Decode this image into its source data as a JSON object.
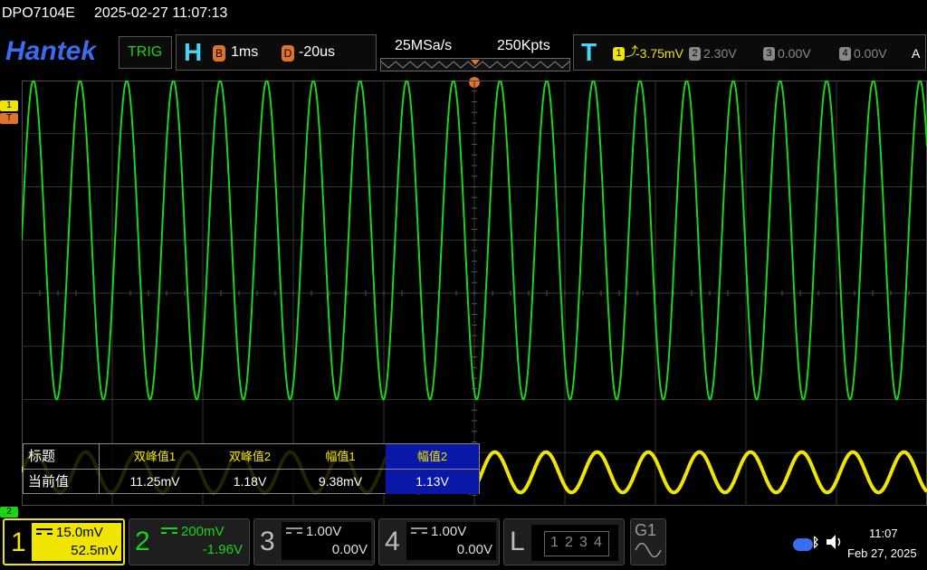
{
  "status": {
    "model": "DPO7104E",
    "datetime": "2025-02-27 11:07:13"
  },
  "header": {
    "brand": "Hantek",
    "trig_button": "TRIG",
    "horizontal": {
      "icon": "H",
      "b_tag": "B",
      "timebase": "1ms",
      "d_tag": "D",
      "delay": "-20us"
    },
    "acquisition": {
      "sample_rate": "25MSa/s",
      "record_length": "250Kpts"
    },
    "trigger": {
      "icon": "T",
      "source_tag": "1",
      "source_level": "-3.75mV",
      "ch2_tag": "2",
      "ch2_level": "2.30V",
      "ch3_tag": "3",
      "ch3_level": "0.00V",
      "ch4_tag": "4",
      "ch4_level": "0.00V",
      "mode": "A",
      "edge_icon": "rising-edge-icon"
    }
  },
  "markers": {
    "ch1": "1",
    "trigger": "T",
    "ch2": "2"
  },
  "waveforms": {
    "ch1": {
      "color": "#f0e500",
      "cycles": 17.7,
      "amplitude_div": 0.38,
      "center_div": -3.37
    },
    "ch2": {
      "color": "#19d419",
      "cycles": 19.4,
      "amplitude_div": 3.0,
      "center_div": 1.0
    }
  },
  "measurements": {
    "header_label": "标题",
    "row_label": "当前值",
    "columns": [
      "双峰值1",
      "双峰值2",
      "幅值1",
      "幅值2"
    ],
    "values": [
      "11.25mV",
      "1.18V",
      "9.38mV",
      "1.13V"
    ]
  },
  "channels": [
    {
      "num": "1",
      "scale": "15.0mV",
      "offset": "52.5mV",
      "color": "#f0e500"
    },
    {
      "num": "2",
      "scale": "200mV",
      "offset": "-1.96V",
      "color": "#19d419"
    },
    {
      "num": "3",
      "scale": "1.00V",
      "offset": "0.00V",
      "color": "#bbbbbb"
    },
    {
      "num": "4",
      "scale": "1.00V",
      "offset": "0.00V",
      "color": "#bbbbbb"
    }
  ],
  "logic": {
    "label": "L",
    "bits": [
      "1",
      "2",
      "3",
      "4"
    ]
  },
  "generator": {
    "label": "G1",
    "icon": "sine-wave-icon"
  },
  "system": {
    "time": "11:07",
    "date": "Feb 27, 2025",
    "usb_icon": "usb-icon",
    "sound_icon": "speaker-icon"
  },
  "colors": {
    "accent": "#3a6cf0",
    "trigger": "#e0742a",
    "h_icon": "#45d7f5",
    "selected": "#0a18a8"
  }
}
